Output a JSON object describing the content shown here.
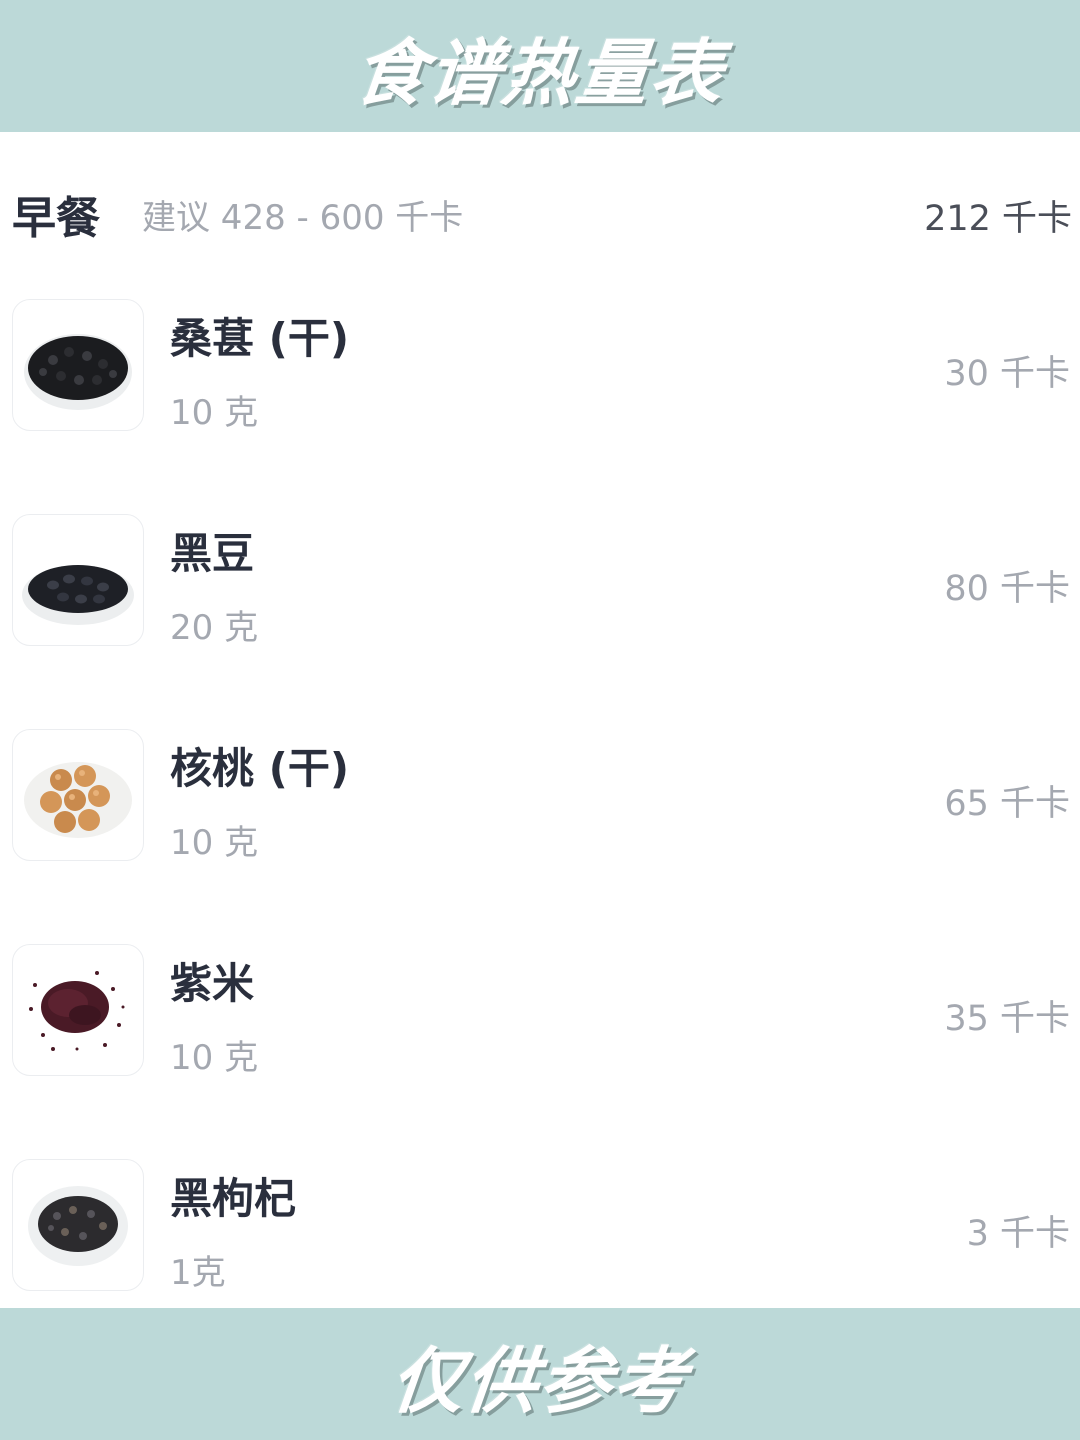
{
  "header": {
    "title": "食谱热量表"
  },
  "meal": {
    "name": "早餐",
    "suggestion": "建议 428 - 600 千卡",
    "total": "212 千卡"
  },
  "foods": [
    {
      "name": "桑葚 (干)",
      "amount": "10 克",
      "kcal": "30 千卡",
      "icon": "dried-mulberry-plate"
    },
    {
      "name": "黑豆",
      "amount": "20 克",
      "kcal": "80 千卡",
      "icon": "black-beans-plate"
    },
    {
      "name": "核桃 (干)",
      "amount": "10 克",
      "kcal": "65 千卡",
      "icon": "walnuts-plate"
    },
    {
      "name": "紫米",
      "amount": "10 克",
      "kcal": "35 千卡",
      "icon": "purple-rice-pile"
    },
    {
      "name": "黑枸杞",
      "amount": "1克",
      "kcal": "3 千卡",
      "icon": "black-goji-plate"
    }
  ],
  "footer": {
    "text": "仅供参考"
  },
  "colors": {
    "banner": "#bcd9d8",
    "title_text": "#2a2f3d",
    "muted_text": "#a4a8b0"
  }
}
